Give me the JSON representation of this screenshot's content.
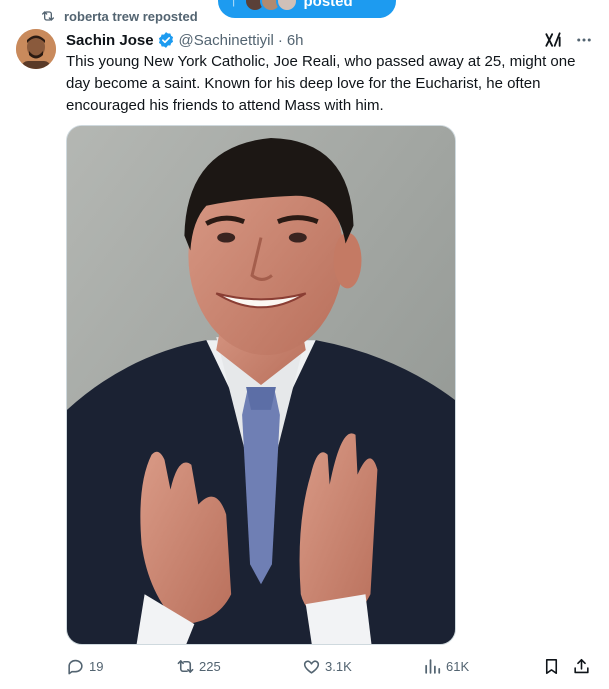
{
  "new_posts_pill": {
    "label": "posted",
    "arrow": "↑"
  },
  "repost": {
    "text": "roberta trew reposted",
    "icon": "retweet-icon"
  },
  "author": {
    "name": "Sachin Jose",
    "handle": "@Sachinettiyil",
    "separator": "·",
    "time": "6h"
  },
  "tweet": {
    "text": "This young New York Catholic, Joe Reali, who passed away at 25, might one day become a saint. Known for his deep love for the Eucharist, he often encouraged his friends to attend Mass with him."
  },
  "actions": {
    "replies": "19",
    "reposts": "225",
    "likes": "3.1K",
    "views": "61K"
  },
  "colors": {
    "accent": "#1d9bf0",
    "muted": "#536471",
    "text": "#0f1419"
  }
}
